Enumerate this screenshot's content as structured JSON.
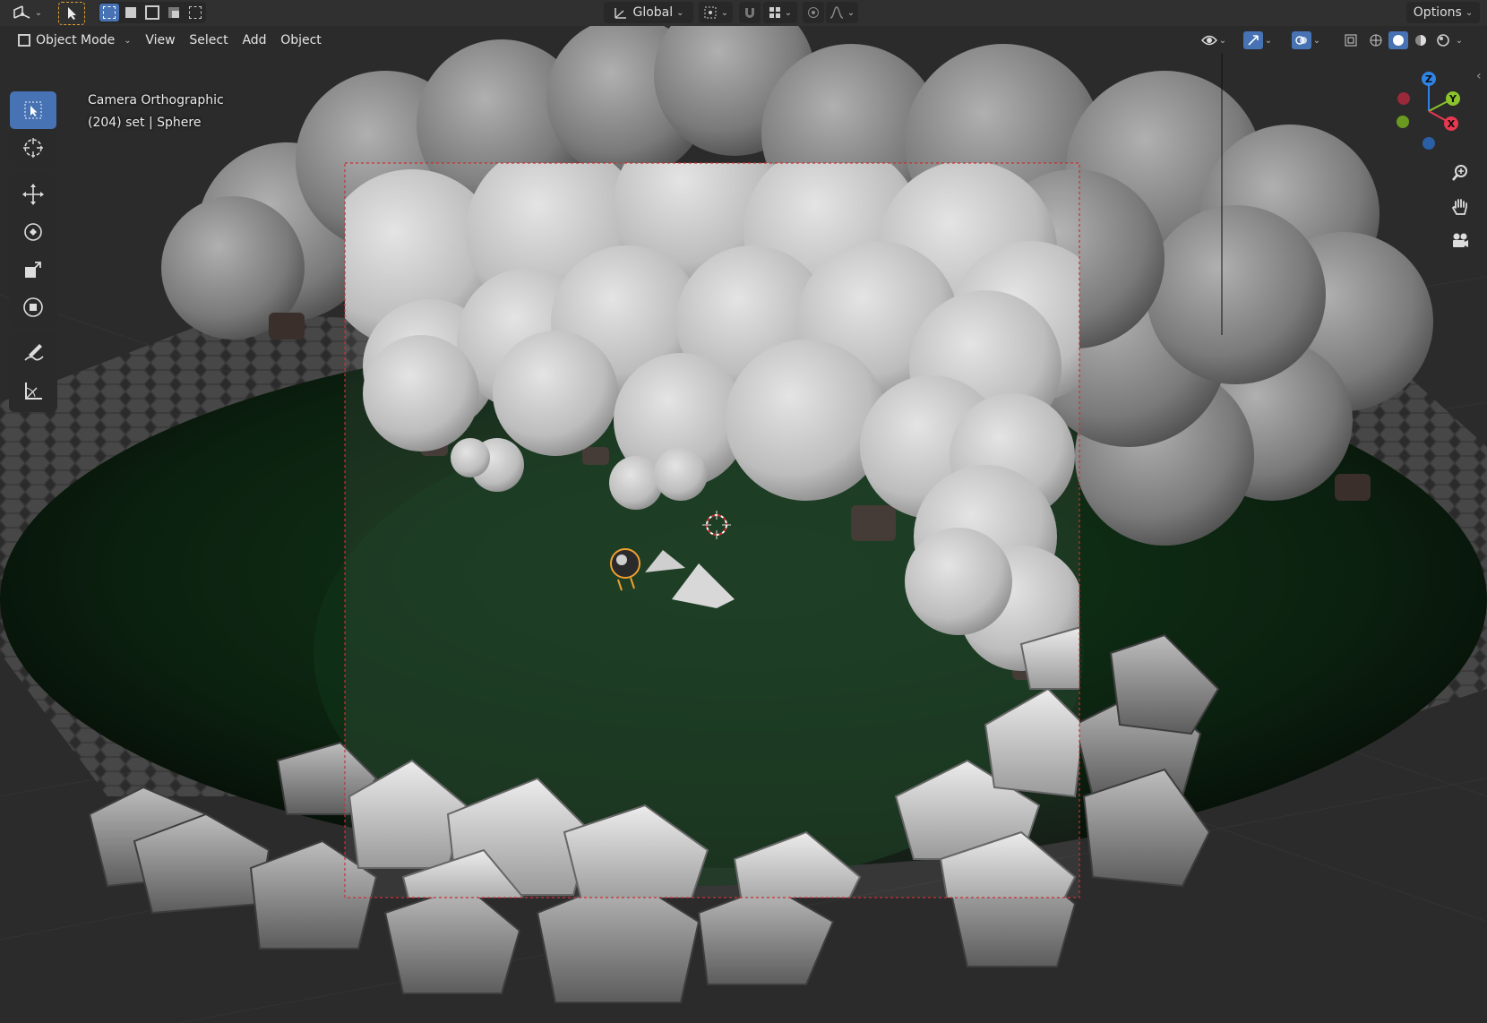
{
  "header": {
    "transform_orientation": "Global",
    "options_label": "Options"
  },
  "menubar": {
    "mode_label": "Object Mode",
    "menus": [
      "View",
      "Select",
      "Add",
      "Object"
    ]
  },
  "viewport": {
    "camera_label": "Camera Orthographic",
    "frame_object_label": "(204) set | Sphere"
  },
  "gizmo": {
    "axes": [
      "Z",
      "Y",
      "X"
    ]
  },
  "colors": {
    "active_tool": "#4772b3",
    "selection_orange": "#f0a030",
    "camera_border": "#c83232",
    "axis_x": "#e8384f",
    "axis_y": "#8ac32a",
    "axis_z": "#2f83e5"
  },
  "icons": {
    "editor_type": "view3d-icon",
    "tools": [
      "select-box-icon",
      "cursor-icon",
      "move-icon",
      "rotate-icon",
      "scale-icon",
      "transform-icon",
      "annotate-icon",
      "measure-icon"
    ],
    "nav": [
      "zoom-icon",
      "pan-hand-icon",
      "camera-view-icon"
    ]
  }
}
